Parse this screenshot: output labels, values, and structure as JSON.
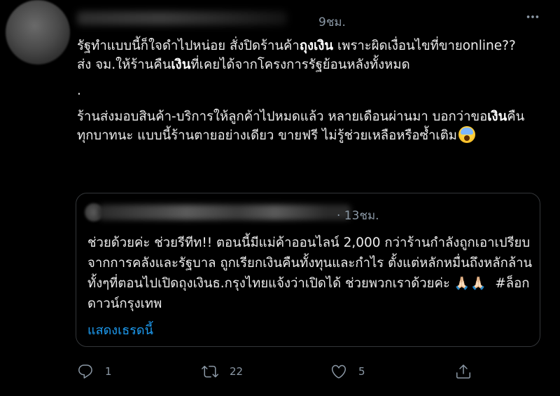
{
  "tweet": {
    "timestamp": "9ชม.",
    "paragraph1_a": "รัฐทำแบบนี้ก็ใจดำไปหน่อย สั่งปิดร้านค้า",
    "paragraph1_b": "ถุงเงิน",
    "paragraph1_c": " เพราะผิดเงื่อนไขที่ขายonline?? ส่ง จม.ให้ร้านคืน",
    "paragraph1_d": "เงิน",
    "paragraph1_e": "ที่เคยได้จากโครงการรัฐย้อนหลังทั้งหมด",
    "dot": ".",
    "paragraph2_a": "ร้านส่งมอบสินค้า-บริการให้ลูกค้าไปหมดแล้ว หลายเดือนผ่านมา บอกว่าขอ",
    "paragraph2_b": "เงิน",
    "paragraph2_c": "คืนทุกบาทนะ แบบนี้ร้านตายอย่างเดียว ขายฟรี ไม่รู้ช่วยเหลือหรือซ้ำเติม"
  },
  "quoted_tweet": {
    "timestamp": "· 13ชม.",
    "text": "ช่วยด้วยค่ะ ช่วยรีทีท!! ตอนนี้มีแม่ค้าออนไลน์ 2,000 กว่าร้านกำลังถูกเอาเปรียบจากการคลังและรัฐบาล ถูกเรียกเงินคืนทั้งทุนและกำไร ตั้งแต่หลักหมื่นถึงหลักล้าน ทั้งๆที่ตอนไปเปิดถุงเงินธ.กรุงไทยแจ้งว่าเปิดได้ ช่วยพวกเราด้วยค่ะ ",
    "emoji": "🙏🏻🙏🏻",
    "hashtag": "  #ล็อกดาวน์กรุงเทพ",
    "show_thread": "แสดงเธรดนี้"
  },
  "actions": {
    "reply_count": "1",
    "retweet_count": "22",
    "like_count": "5"
  },
  "colors": {
    "background": "#000000",
    "secondary_text": "#8b98a5",
    "link": "#1d9bf0",
    "border": "#333639"
  }
}
